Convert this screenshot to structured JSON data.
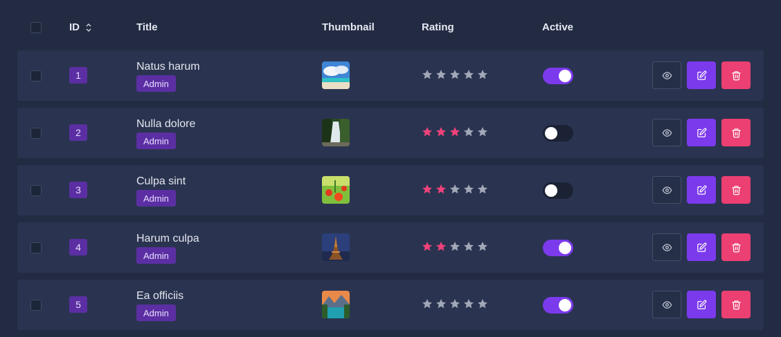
{
  "header": {
    "id": "ID",
    "title": "Title",
    "thumbnail": "Thumbnail",
    "rating": "Rating",
    "active": "Active"
  },
  "rows": [
    {
      "id": "1",
      "title": "Natus harum",
      "role": "Admin",
      "rating": 0,
      "active": true,
      "thumbnail": "beach"
    },
    {
      "id": "2",
      "title": "Nulla dolore",
      "role": "Admin",
      "rating": 3,
      "active": false,
      "thumbnail": "waterfall"
    },
    {
      "id": "3",
      "title": "Culpa sint",
      "role": "Admin",
      "rating": 2,
      "active": false,
      "thumbnail": "poppies"
    },
    {
      "id": "4",
      "title": "Harum culpa",
      "role": "Admin",
      "rating": 2,
      "active": true,
      "thumbnail": "eiffel-tower"
    },
    {
      "id": "5",
      "title": "Ea officiis",
      "role": "Admin",
      "rating": 0,
      "active": true,
      "thumbnail": "mountain-lake"
    }
  ],
  "rating_max": 5,
  "colors": {
    "star_filled": "#f0427a",
    "star_empty": "#a2a8b8",
    "accent": "#7c3aed",
    "danger": "#ec3f72",
    "badge": "#5b2fa3"
  },
  "icons": {
    "view": "eye-icon",
    "edit": "edit-icon",
    "delete": "trash-icon",
    "sort": "sort-icon"
  }
}
